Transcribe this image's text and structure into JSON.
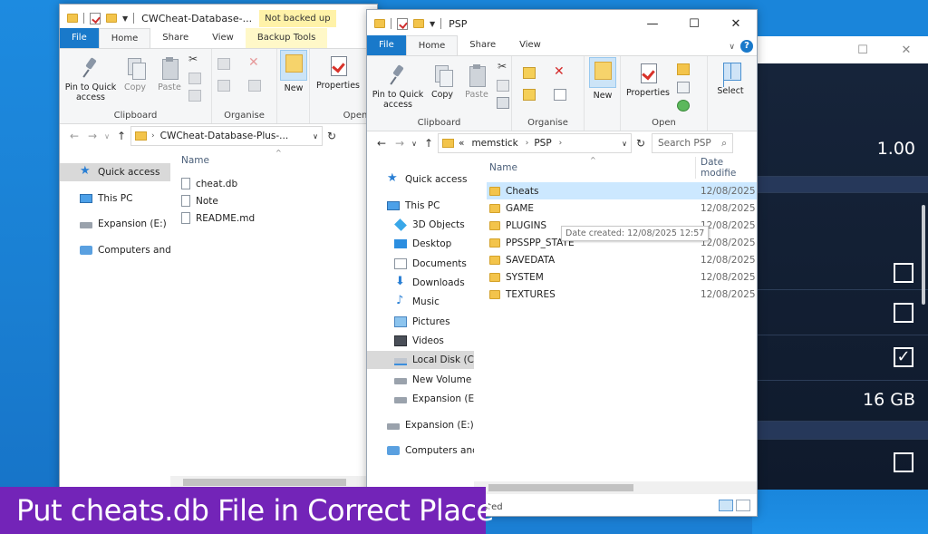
{
  "colors": {
    "accent": "#1979ca",
    "caption_bg": "#7324b8",
    "warning_badge": "#fff2a8"
  },
  "left_window": {
    "title": "CWCheat-Database-...",
    "badge": "Not backed up",
    "tabs": [
      "File",
      "Home",
      "Share",
      "View",
      "Backup Tools"
    ],
    "ribbon": {
      "pin": "Pin to Quick access",
      "copy": "Copy",
      "paste": "Paste",
      "clipboard": "Clipboard",
      "organise": "Organise",
      "new": "New",
      "properties": "Properties",
      "open": "Open"
    },
    "address": "CWCheat-Database-Plus-...",
    "nav": [
      "Quick access",
      "This PC",
      "Expansion (E:)",
      "Computers and"
    ],
    "column_name": "Name",
    "files": [
      "cheat.db",
      "Note",
      "README.md"
    ]
  },
  "right_window": {
    "title": "PSP",
    "tabs": [
      "File",
      "Home",
      "Share",
      "View"
    ],
    "ribbon": {
      "pin": "Pin to Quick access",
      "copy": "Copy",
      "paste": "Paste",
      "new": "New",
      "properties": "Properties",
      "select": "Select",
      "clipboard": "Clipboard",
      "organise": "Organise",
      "open": "Open"
    },
    "address": {
      "prefix": "«",
      "parts": [
        "memstick",
        "PSP"
      ]
    },
    "search_placeholder": "Search PSP",
    "nav": [
      "Quick access",
      "This PC",
      "3D Objects",
      "Desktop",
      "Documents",
      "Downloads",
      "Music",
      "Pictures",
      "Videos",
      "Local Disk (C:)",
      "New Volume (I",
      "Expansion (E:)",
      "Expansion (E:)",
      "Computers and"
    ],
    "columns": {
      "name": "Name",
      "date": "Date modifie"
    },
    "folders": [
      {
        "name": "Cheats",
        "date": "12/08/2025 1"
      },
      {
        "name": "GAME",
        "date": "12/08/2025 1"
      },
      {
        "name": "PLUGINS",
        "date": "12/08/2025 1"
      },
      {
        "name": "PPSSPP_STATE",
        "date": "12/08/2025 1"
      },
      {
        "name": "SAVEDATA",
        "date": "12/08/2025 1"
      },
      {
        "name": "SYSTEM",
        "date": "12/08/2025 1"
      },
      {
        "name": "TEXTURES",
        "date": "12/08/2025 1"
      }
    ],
    "tooltip": "Date created: 12/08/2025 12:57",
    "status_fragment": "sted"
  },
  "ppsspp": {
    "values": [
      "1.00",
      "16 GB"
    ],
    "checkboxes": [
      {
        "checked": false,
        "mark": ""
      },
      {
        "checked": false,
        "mark": ""
      },
      {
        "checked": true,
        "mark": "✓"
      },
      {
        "checked": false,
        "mark": ""
      }
    ]
  },
  "caption": "Put cheats.db File in Correct Place"
}
